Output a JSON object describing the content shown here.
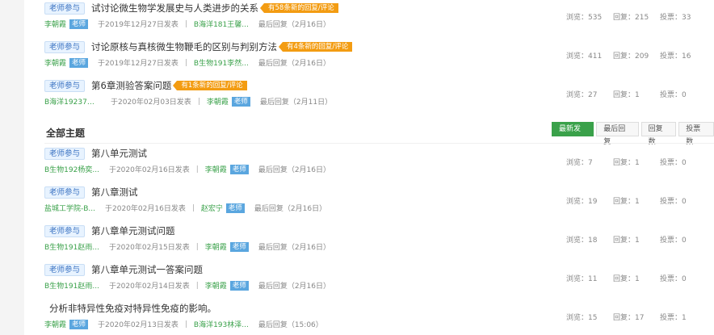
{
  "pinned_topics": [
    {
      "tag": "老师参与",
      "title": "试讨论微生物学发展史与人类进步的关系",
      "badge": "有58条新的回复/评论",
      "author": "李朝霞",
      "role": "老师",
      "date": "于2019年12月27日发表",
      "last_replier": "B海洋181王馨...",
      "last_reply": "最后回复（2月16日）",
      "views": "浏览：535",
      "replies": "回复：215",
      "votes": "投票：33"
    },
    {
      "tag": "老师参与",
      "title": "讨论原核与真核微生物鞭毛的区别与判别方法",
      "badge": "有4条新的回复/评论",
      "author": "李朝霞",
      "role": "老师",
      "date": "于2019年12月27日发表",
      "last_replier": "B生物191李然...",
      "last_reply": "最后回复（2月16日）",
      "views": "浏览：411",
      "replies": "回复：209",
      "votes": "投票：16"
    },
    {
      "tag": "老师参与",
      "title": "第6章测验答案问题",
      "badge": "有1条新的回复/评论",
      "author": "B海洋19237吴...",
      "role": "",
      "date": "于2020年02月03日发表",
      "last_replier": "李朝霞",
      "last_role": "老师",
      "last_reply": "最后回复（2月11日）",
      "views": "浏览：27",
      "replies": "回复：1",
      "votes": "投票：0"
    }
  ],
  "section": {
    "title": "全部主题",
    "sort_tabs": [
      "最新发表",
      "最后回复",
      "回复数",
      "投票数"
    ]
  },
  "topics": [
    {
      "tag": "老师参与",
      "title": "第八单元测试",
      "author": "B生物192杨奕...",
      "role": "",
      "date": "于2020年02月16日发表",
      "last_replier": "李朝霞",
      "last_role": "老师",
      "last_reply": "最后回复（2月16日）",
      "views": "浏览：7",
      "replies": "回复：1",
      "votes": "投票：0"
    },
    {
      "tag": "老师参与",
      "title": "第八章测试",
      "author": "盐城工学院-B...",
      "role": "",
      "date": "于2020年02月16日发表",
      "last_replier": "赵宏宁",
      "last_role": "老师",
      "last_reply": "最后回复（2月16日）",
      "views": "浏览：19",
      "replies": "回复：1",
      "votes": "投票：0"
    },
    {
      "tag": "老师参与",
      "title": "第八章单元测试问题",
      "author": "B生物191赵雨...",
      "role": "",
      "date": "于2020年02月15日发表",
      "last_replier": "李朝霞",
      "last_role": "老师",
      "last_reply": "最后回复（2月16日）",
      "views": "浏览：18",
      "replies": "回复：1",
      "votes": "投票：0"
    },
    {
      "tag": "老师参与",
      "title": "第八章单元测试一答案问题",
      "author": "B生物191赵雨...",
      "role": "",
      "date": "于2020年02月14日发表",
      "last_replier": "李朝霞",
      "last_role": "老师",
      "last_reply": "最后回复（2月16日）",
      "views": "浏览：11",
      "replies": "回复：1",
      "votes": "投票：0"
    },
    {
      "tag": "",
      "title": "分析非特异性免疫对特异性免疫的影响。",
      "author": "李朝霞",
      "role": "老师",
      "date": "于2020年02月13日发表",
      "last_replier": "B海洋193林泽...",
      "last_reply": "最后回复（15:06）",
      "views": "浏览：15",
      "replies": "回复：17",
      "votes": "投票：1"
    }
  ]
}
